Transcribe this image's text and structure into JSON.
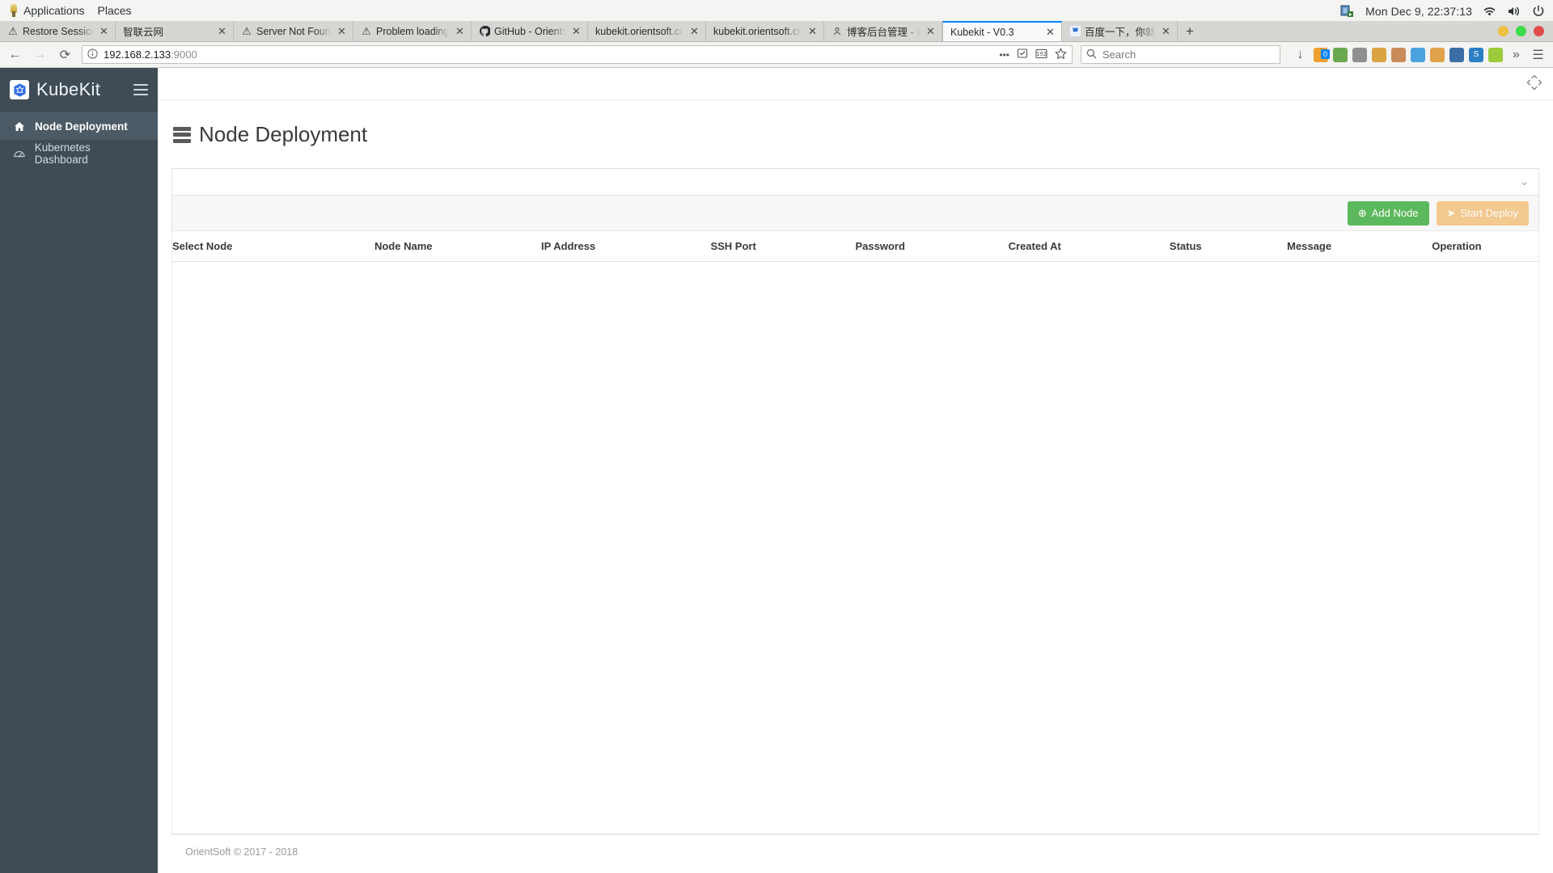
{
  "desktop": {
    "menus": [
      "Applications",
      "Places"
    ],
    "clock": "Mon Dec  9, 22:37:13",
    "app_icon": "gnome-foot-icon",
    "tray": [
      "software-updates-icon",
      "wifi-icon",
      "volume-icon",
      "power-icon"
    ]
  },
  "browser": {
    "tabs": [
      {
        "label": "Restore Session",
        "favicon": "warning-icon",
        "active": false
      },
      {
        "label": "智联云网",
        "favicon": "none",
        "active": false
      },
      {
        "label": "Server Not Found",
        "favicon": "warning-icon",
        "active": false
      },
      {
        "label": "Problem loading p",
        "favicon": "warning-icon",
        "active": false
      },
      {
        "label": "GitHub - Orientso",
        "favicon": "github-icon",
        "active": false
      },
      {
        "label": "kubekit.orientsoft.cn/",
        "favicon": "none",
        "active": false
      },
      {
        "label": "kubekit.orientsoft.cn/",
        "favicon": "none",
        "active": false
      },
      {
        "label": "博客后台管理 - 博",
        "favicon": "person-icon",
        "active": false
      },
      {
        "label": "Kubekit - V0.3",
        "favicon": "none",
        "active": true
      },
      {
        "label": "百度一下，你就知",
        "favicon": "baidu-icon",
        "active": false
      }
    ],
    "new_tab_label": "+",
    "close_label": "✕",
    "nav": {
      "back": "←",
      "forward": "→",
      "reload": "⟳"
    },
    "url": {
      "scheme_host": "192.168.2.133",
      "port": ":9000",
      "info_icon": "page-info-icon"
    },
    "url_icons": [
      "more-options-icon",
      "reader-mode-icon",
      "translate-icon",
      "bookmark-star-icon"
    ],
    "search": {
      "placeholder": "Search",
      "icon": "search-icon"
    },
    "download_badge": "0",
    "window_controls": [
      "minimize",
      "maximize",
      "close"
    ]
  },
  "app": {
    "brand": {
      "name": "KubeKit",
      "logo": "kubernetes-logo-icon",
      "menu_toggle": "hamburger-icon"
    },
    "sidebar": {
      "items": [
        {
          "label": "Node Deployment",
          "icon": "home-icon",
          "active": true
        },
        {
          "label": "Kubernetes Dashboard",
          "icon": "dashboard-icon",
          "active": false
        }
      ]
    },
    "topbar": {
      "expand_icon": "expand-arrows-icon"
    },
    "page_title": {
      "text": "Node Deployment",
      "icon": "server-rack-icon"
    },
    "cluster_select": {
      "value": "",
      "placeholder": "",
      "caret": "chevron-down-icon"
    },
    "buttons": {
      "add_node": {
        "label": "Add Node",
        "icon": "plus-circle-icon",
        "color": "#5cb85c"
      },
      "start_deploy": {
        "label": "Start Deploy",
        "icon": "paper-plane-icon",
        "color": "#f0ad4e",
        "disabled": true
      }
    },
    "table": {
      "columns": [
        "Select Node",
        "Node Name",
        "IP Address",
        "SSH Port",
        "Password",
        "Created At",
        "Status",
        "Message",
        "Operation"
      ],
      "rows": []
    },
    "footer": {
      "text": "OrientSoft © 2017 - 2018"
    }
  }
}
